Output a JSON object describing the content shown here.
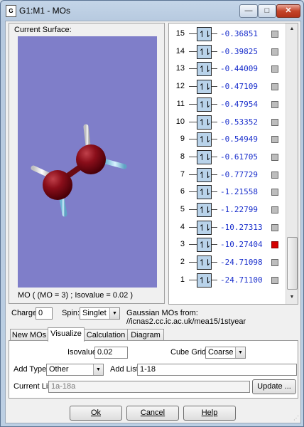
{
  "window": {
    "title": "G1:M1 - MOs",
    "app_icon_text": "G"
  },
  "titlebar_buttons": {
    "minimize": "—",
    "maximize": "□",
    "close": "✕"
  },
  "viewer": {
    "label": "Current Surface:",
    "caption": "MO ( (MO = 3) ; Isovalue = 0.02 )",
    "background": "#7f7ec9"
  },
  "mo_list": {
    "occupancy_glyph": "↿⇂",
    "items": [
      {
        "num": "15",
        "energy": "-0.36851",
        "selected": false
      },
      {
        "num": "14",
        "energy": "-0.39825",
        "selected": false
      },
      {
        "num": "13",
        "energy": "-0.44009",
        "selected": false
      },
      {
        "num": "12",
        "energy": "-0.47109",
        "selected": false
      },
      {
        "num": "11",
        "energy": "-0.47954",
        "selected": false
      },
      {
        "num": "10",
        "energy": "-0.53352",
        "selected": false
      },
      {
        "num": "9",
        "energy": "-0.54949",
        "selected": false
      },
      {
        "num": "8",
        "energy": "-0.61705",
        "selected": false
      },
      {
        "num": "7",
        "energy": "-0.77729",
        "selected": false
      },
      {
        "num": "6",
        "energy": "-1.21558",
        "selected": false
      },
      {
        "num": "5",
        "energy": "-1.22799",
        "selected": false
      },
      {
        "num": "4",
        "energy": "-10.27313",
        "selected": false
      },
      {
        "num": "3",
        "energy": "-10.27404",
        "selected": true
      },
      {
        "num": "2",
        "energy": "-24.71098",
        "selected": false
      },
      {
        "num": "1",
        "energy": "-24.71100",
        "selected": false
      }
    ],
    "energy_color": "#1a2fcc",
    "selected_color": "#d40000"
  },
  "controls": {
    "charge_label": "Charge:",
    "charge_value": "0",
    "spin_label": "Spin:",
    "spin_value": "Singlet",
    "source_text": "Gaussian MOs from:  //icnas2.cc.ic.ac.uk/mea15/1styear"
  },
  "tabs": [
    "New MOs",
    "Visualize",
    "Calculation",
    "Diagram"
  ],
  "active_tab": "Visualize",
  "visualize": {
    "isovalue_label": "Isovalue:",
    "isovalue": "0.02",
    "cube_grid_label": "Cube Grid:",
    "cube_grid": "Coarse",
    "add_type_label": "Add Type:",
    "add_type": "Other",
    "add_list_label": "Add List:",
    "add_list": "1-18",
    "current_list_label": "Current List:",
    "current_list": "1a-18a",
    "update_label": "Update ..."
  },
  "buttons": {
    "ok": "Ok",
    "cancel": "Cancel",
    "help": "Help"
  }
}
